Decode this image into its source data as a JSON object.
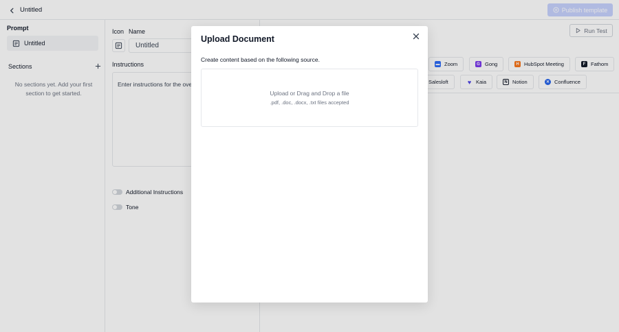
{
  "topbar": {
    "title": "Untitled",
    "publish_label": "Publish template"
  },
  "left": {
    "prompt_label": "Prompt",
    "prompt_item": "Untitled",
    "sections_label": "Sections",
    "sections_empty": "No sections yet. Add your first section to get started."
  },
  "middle": {
    "icon_label": "Icon",
    "name_label": "Name",
    "name_value": "Untitled",
    "instructions_label": "Instructions",
    "instructions_placeholder": "Enter instructions for the ove",
    "toggle_additional": "Additional Instructions",
    "toggle_tone": "Tone"
  },
  "right": {
    "run_test_label": "Run Test",
    "sources": [
      {
        "name": "Zoom",
        "color": "#2d6cf6"
      },
      {
        "name": "Gong",
        "color": "#7c3aed"
      },
      {
        "name": "HubSpot Meeting",
        "color": "#f97316"
      },
      {
        "name": "Fathom",
        "color": "#111827"
      },
      {
        "name": "Salesloft",
        "color": ""
      },
      {
        "name": "Kaia",
        "color": "#4f46e5"
      },
      {
        "name": "Notion",
        "color": "#111827"
      },
      {
        "name": "Confluence",
        "color": "#2563eb"
      }
    ]
  },
  "modal": {
    "title": "Upload Document",
    "subtitle": "Create content based on the following source.",
    "dropzone_main": "Upload or Drag and Drop a file",
    "dropzone_hint": ".pdf, .doc, .docx, .txt files accepted"
  },
  "colors": {
    "accent": "#c7d2fe",
    "border": "#e5e7eb",
    "text": "#111827",
    "muted": "#6b7280"
  }
}
